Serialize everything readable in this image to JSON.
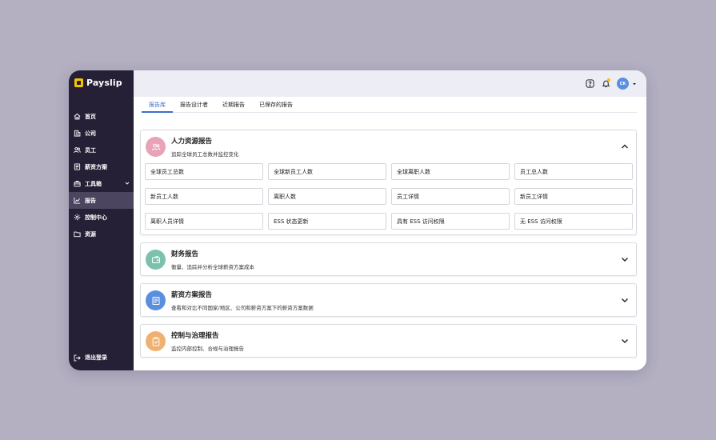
{
  "app": {
    "name": "Payslip"
  },
  "sidebar": {
    "items": [
      {
        "label": "首页",
        "icon": "home-icon"
      },
      {
        "label": "公司",
        "icon": "building-icon"
      },
      {
        "label": "员工",
        "icon": "users-icon"
      },
      {
        "label": "薪资方案",
        "icon": "document-icon"
      },
      {
        "label": "工具箱",
        "icon": "toolbox-icon"
      },
      {
        "label": "报告",
        "icon": "chart-icon"
      },
      {
        "label": "控制中心",
        "icon": "gear-icon"
      },
      {
        "label": "资源",
        "icon": "folder-icon"
      }
    ],
    "active_index": 5,
    "logout_label": "退出登录"
  },
  "header": {
    "avatar_initials": "CK"
  },
  "tabs": [
    {
      "label": "报告库"
    },
    {
      "label": "报告设计者"
    },
    {
      "label": "近期报告"
    },
    {
      "label": "已保存的报告"
    }
  ],
  "sections": [
    {
      "title": "人力资源报告",
      "description": "追踪全球员工总数并监控变化",
      "icon_color": "#e8a3b6",
      "expanded": true,
      "items": [
        "全球员工总数",
        "全球新员工人数",
        "全球离职人数",
        "员工总人数",
        "新员工人数",
        "离职人数",
        "员工详情",
        "新员工详情",
        "离职人员详情",
        "ESS 状态更新",
        "具有 ESS 访问权限",
        "无 ESS 访问权限"
      ]
    },
    {
      "title": "财务报告",
      "description": "衡量、追踪并分析全球薪资方案成本",
      "icon_color": "#7cc1ad",
      "expanded": false
    },
    {
      "title": "薪资方案报告",
      "description": "查看和对比不同国家/地区、公司和薪资方案下的薪资方案数据",
      "icon_color": "#5a8fe0",
      "expanded": false
    },
    {
      "title": "控制与治理报告",
      "description": "监控内部控制、合规与治理报告",
      "icon_color": "#f0b070",
      "expanded": false
    }
  ],
  "colors": {
    "sidebar_bg": "#262036",
    "accent": "#3d6fc9",
    "logo": "#f5c400"
  }
}
